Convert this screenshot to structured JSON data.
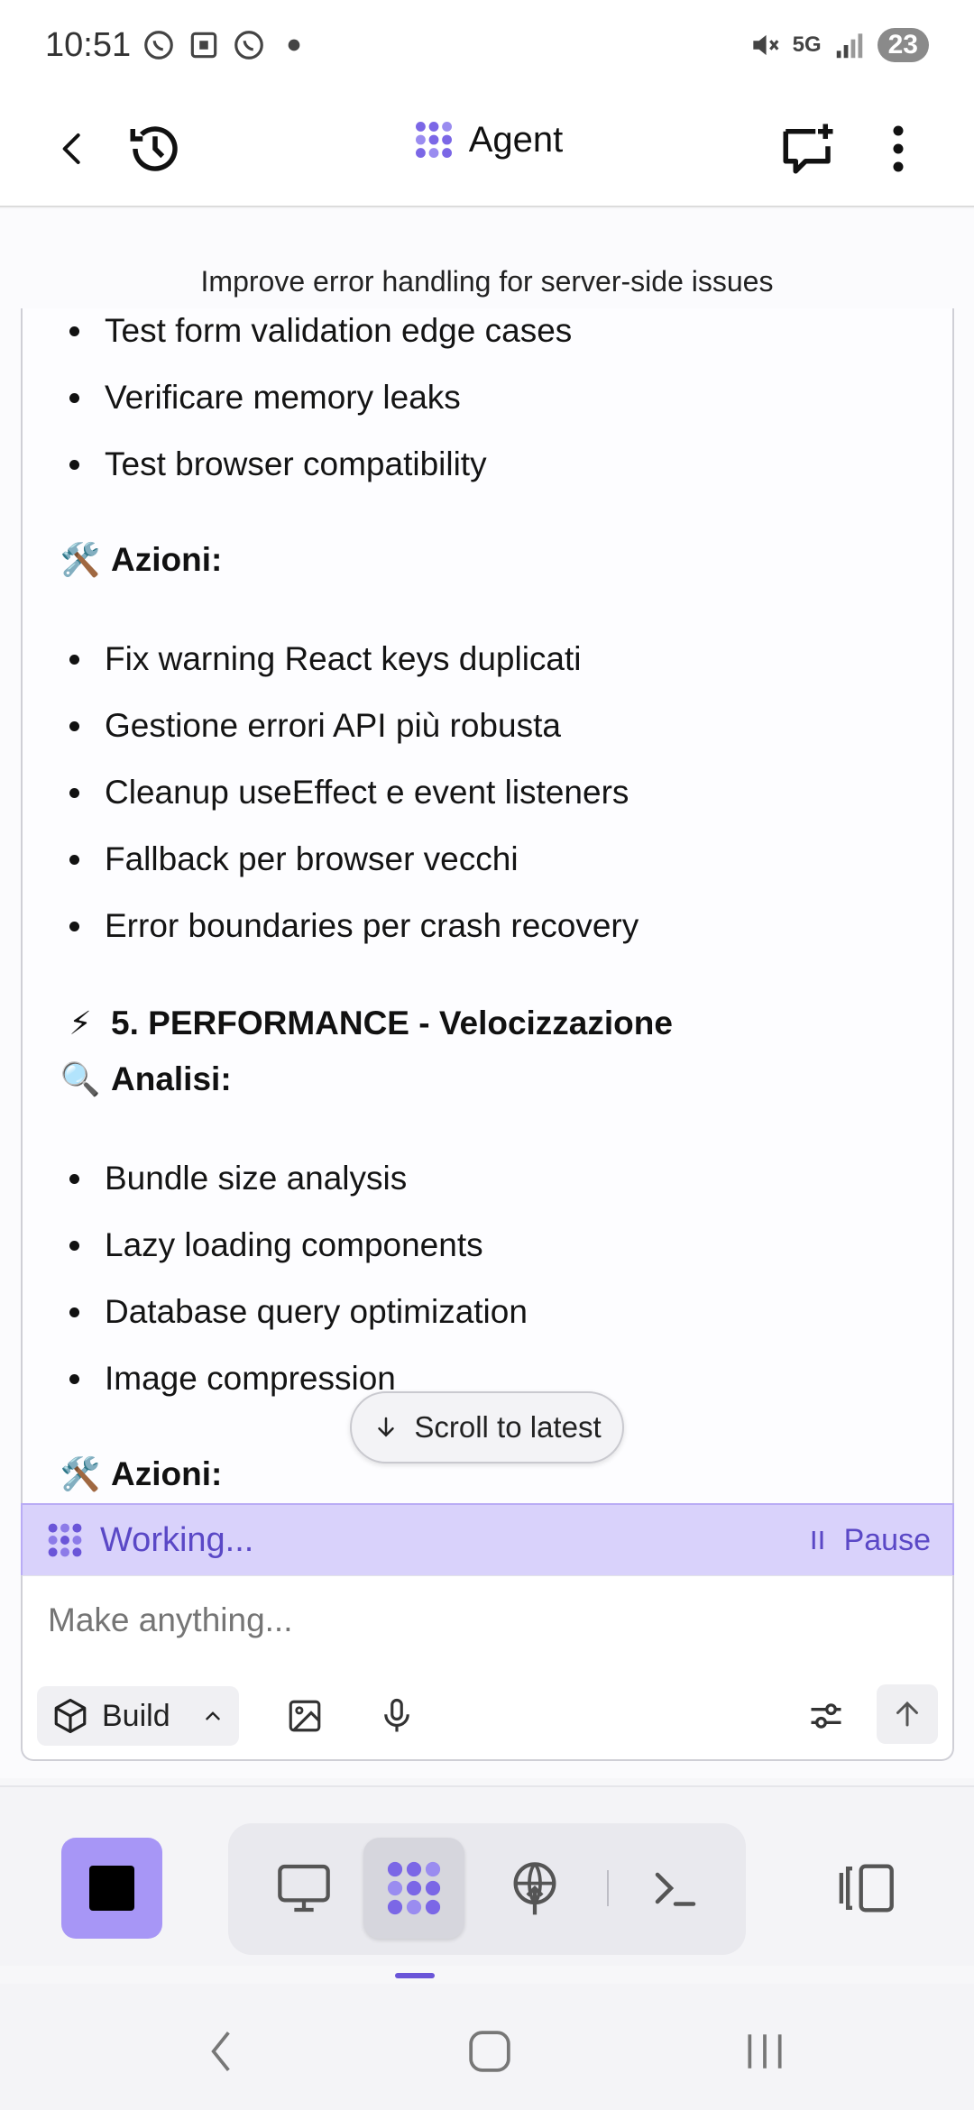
{
  "status_bar": {
    "time": "10:51",
    "network": "5G",
    "battery": "23"
  },
  "header": {
    "title": "Agent"
  },
  "task": {
    "title": "Improve error handling for server-side issues"
  },
  "message": {
    "test_items": [
      "Test form validation edge cases",
      "Verificare memory leaks",
      "Test browser compatibility"
    ],
    "actions_heading_1": "Azioni:",
    "action_items": [
      "Fix warning React keys duplicati",
      "Gestione errori API più robusta",
      "Cleanup useEffect e event listeners",
      "Fallback per browser vecchi",
      "Error boundaries per crash recovery"
    ],
    "section_heading": "5. PERFORMANCE - Velocizzazione",
    "analysis_heading": "Analisi:",
    "analysis_items": [
      "Bundle size analysis",
      "Lazy loading components",
      "Database query optimization",
      "Image compression"
    ],
    "actions_heading_2": "Azioni:",
    "emojis": {
      "tools": "🛠️",
      "lightning": "⚡",
      "magnifier": "🔍"
    }
  },
  "scroll_latest": {
    "label": "Scroll to latest"
  },
  "working": {
    "label": "Working...",
    "pause_label": "Pause"
  },
  "composer": {
    "placeholder": "Make anything...",
    "mode_label": "Build"
  },
  "colors": {
    "accent": "#6a55d8",
    "working_bg": "#d9d2fb",
    "stop_bg": "#a796f6"
  }
}
